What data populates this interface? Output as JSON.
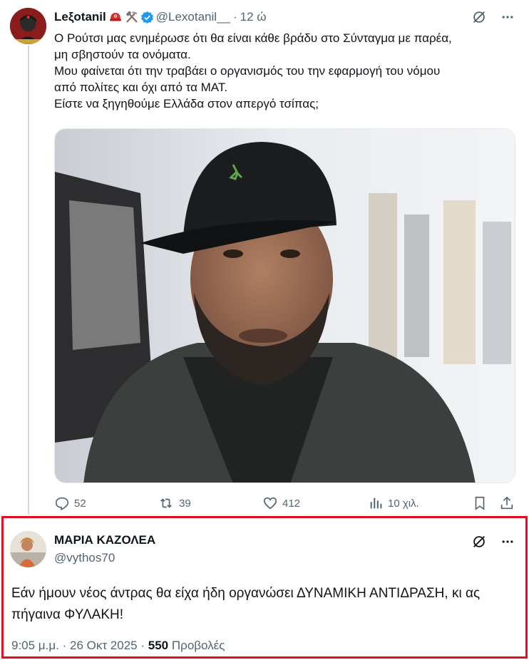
{
  "tweet1": {
    "author_name": "Leξotanil",
    "handle": "@Lexotanil__",
    "separator": "·",
    "time": "12 ώ",
    "lines": [
      "Ο Ρούτσι μας ενημέρωσε ότι θα είναι κάθε βράδυ στο Σύνταγμα με παρέα,",
      "μη σβηστούν τα ονόματα.",
      "Μου φαίνεται ότι την τραβάει ο οργανισμός του την εφαρμογή του νόμου",
      "από πολίτες και όχι από τα ΜΑΤ.",
      "Είστε να ξηγηθούμε Ελλάδα στον απεργό τσίπας;"
    ],
    "stats": {
      "replies": "52",
      "reposts": "39",
      "likes": "412",
      "views": "10 χιλ."
    },
    "badges": [
      "helmet-emoji",
      "hammer-pick-emoji",
      "verified-badge"
    ]
  },
  "tweet2": {
    "author_name": "ΜΑΡΙΑ ΚΑΖΟΛΕΑ",
    "handle": "@vythos70",
    "text": "Εάν ήμουν νέος άντρας θα είχα ήδη οργανώσει ΔΥΝΑΜΙΚΗ ΑΝΤΙΔΡΑΣΗ, κι ας πήγαινα ΦΥΛΑΚΗ!",
    "time": "9:05 μ.μ.",
    "separator": "·",
    "date": "26 Οκτ 2025",
    "separator2": "·",
    "views_count": "550",
    "views_label": "Προβολές"
  },
  "colors": {
    "text": "#0f1419",
    "secondary": "#536471",
    "verified": "#1d9bf0",
    "highlight_border": "#e0101f",
    "thread_line": "#cfd9de"
  }
}
